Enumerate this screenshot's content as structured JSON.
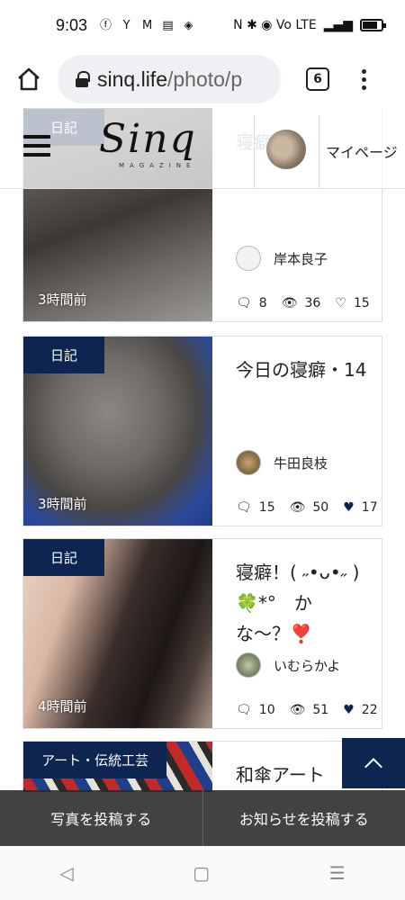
{
  "status_bar": {
    "time": "9:03",
    "right_text": "N ✱ ◉ Vo LTE"
  },
  "browser": {
    "url_host": "sinq.life",
    "url_path": "/photo/p",
    "tab_count": "6"
  },
  "header": {
    "logo": "Sinq",
    "logo_sub": "MAGAZINE",
    "mypage_label": "マイページ"
  },
  "top_card": {
    "category": "日記",
    "title": "寝癖",
    "time_ago": "3時間前",
    "author": "岸本良子",
    "comments": "8",
    "views": "36",
    "likes": "15",
    "liked": false
  },
  "cards": [
    {
      "category": "日記",
      "title": "今日の寝癖・14",
      "time_ago": "3時間前",
      "author": "牛田良枝",
      "comments": "15",
      "views": "50",
      "likes": "17",
      "liked": true
    },
    {
      "category": "日記",
      "title": "寝癖！( ˶•ᴗ•˶ )🍀*°　かな〜？❣️",
      "time_ago": "4時間前",
      "author": "いむらかよ",
      "comments": "10",
      "views": "51",
      "likes": "22",
      "liked": true
    },
    {
      "category": "アート・伝統工芸",
      "title": "和傘アート"
    }
  ],
  "action_bar": {
    "post_photo": "写真を投稿する",
    "post_news": "お知らせを投稿する"
  }
}
